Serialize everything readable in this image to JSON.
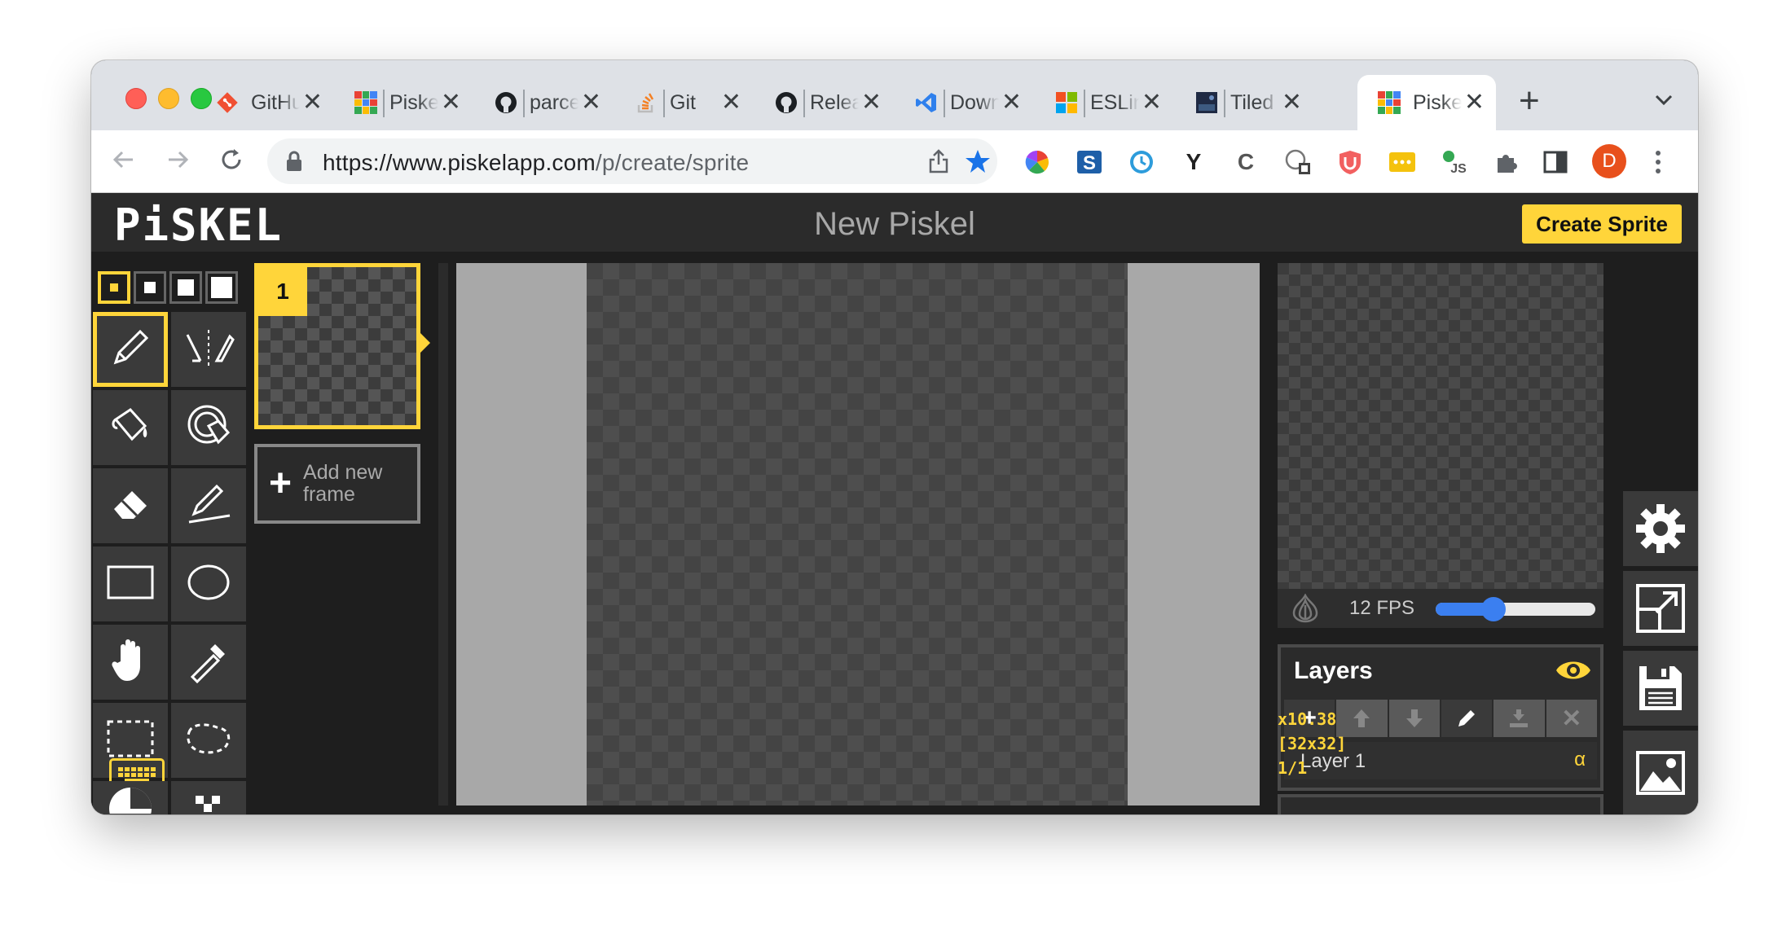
{
  "browser": {
    "tabs": [
      {
        "title": "GitHub",
        "icon": "git-icon",
        "active": false
      },
      {
        "title": "Piskel",
        "icon": "piskel-icon",
        "active": false
      },
      {
        "title": "parcel",
        "icon": "github-icon",
        "active": false
      },
      {
        "title": "Git",
        "icon": "stackoverflow-icon",
        "active": false
      },
      {
        "title": "Releases",
        "icon": "github-icon",
        "active": false
      },
      {
        "title": "Download",
        "icon": "vscode-icon",
        "active": false
      },
      {
        "title": "ESLint",
        "icon": "microsoft-icon",
        "active": false
      },
      {
        "title": "Tiled",
        "icon": "tiled-icon",
        "active": false
      },
      {
        "title": "Piskel",
        "icon": "piskel-icon",
        "active": true
      }
    ],
    "tab_close": "✕",
    "new_tab": "+",
    "url_host": "https://www.piskelapp.com",
    "url_path": "/p/create/sprite",
    "avatar_letter": "D"
  },
  "app": {
    "logo": "PiSKEL",
    "title": "New Piskel",
    "create_button": "Create Sprite",
    "frames": [
      {
        "number": "1"
      }
    ],
    "add_frame_label": "Add new frame",
    "fps_label": "12 FPS",
    "fps_value": 12,
    "fps_slider_fraction": 0.36,
    "layers_title": "Layers",
    "layer_name": "Layer 1",
    "layer_alpha": "α",
    "debug": {
      "zoom": "x10.38",
      "size": "[32x32]",
      "frame": "1/1"
    }
  },
  "colors": {
    "accent": "#ffd53a",
    "slider": "#3b7ff0",
    "background": "#1e1e1e"
  }
}
